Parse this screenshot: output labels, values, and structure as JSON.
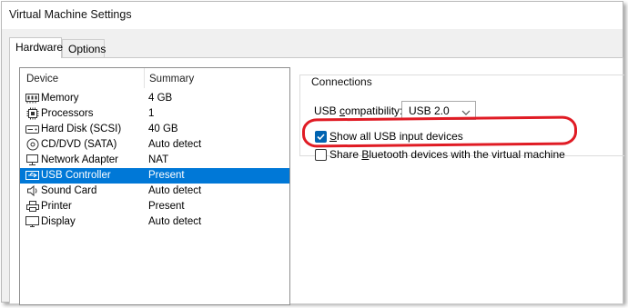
{
  "window": {
    "title": "Virtual Machine Settings"
  },
  "tabs": [
    {
      "label": "Hardware",
      "active": true
    },
    {
      "label": "Options",
      "active": false
    }
  ],
  "device_list": {
    "columns": {
      "device": "Device",
      "summary": "Summary"
    },
    "rows": [
      {
        "icon": "memory-icon",
        "name": "Memory",
        "summary": "4 GB"
      },
      {
        "icon": "processor-icon",
        "name": "Processors",
        "summary": "1"
      },
      {
        "icon": "hard-disk-icon",
        "name": "Hard Disk (SCSI)",
        "summary": "40 GB"
      },
      {
        "icon": "cd-dvd-icon",
        "name": "CD/DVD (SATA)",
        "summary": "Auto detect"
      },
      {
        "icon": "network-adapter-icon",
        "name": "Network Adapter",
        "summary": "NAT"
      },
      {
        "icon": "usb-controller-icon",
        "name": "USB Controller",
        "summary": "Present",
        "selected": true
      },
      {
        "icon": "sound-card-icon",
        "name": "Sound Card",
        "summary": "Auto detect"
      },
      {
        "icon": "printer-icon",
        "name": "Printer",
        "summary": "Present"
      },
      {
        "icon": "display-icon",
        "name": "Display",
        "summary": "Auto detect"
      }
    ]
  },
  "connections": {
    "group_label": "Connections",
    "usb_compat": {
      "pre": "USB ",
      "accel": "c",
      "post": "ompatibility:"
    },
    "usb_compat_value": "USB 2.0",
    "show_all_usb": {
      "accel": "S",
      "rest": "how all USB input devices",
      "checked": true
    },
    "share_bluetooth": {
      "pre": "Share ",
      "accel": "B",
      "rest": "luetooth devices with the virtual machine",
      "checked": false
    }
  },
  "colors": {
    "selection": "#0078d7",
    "checkbox_checked": "#0063b1",
    "annotation": "#e01b24"
  }
}
